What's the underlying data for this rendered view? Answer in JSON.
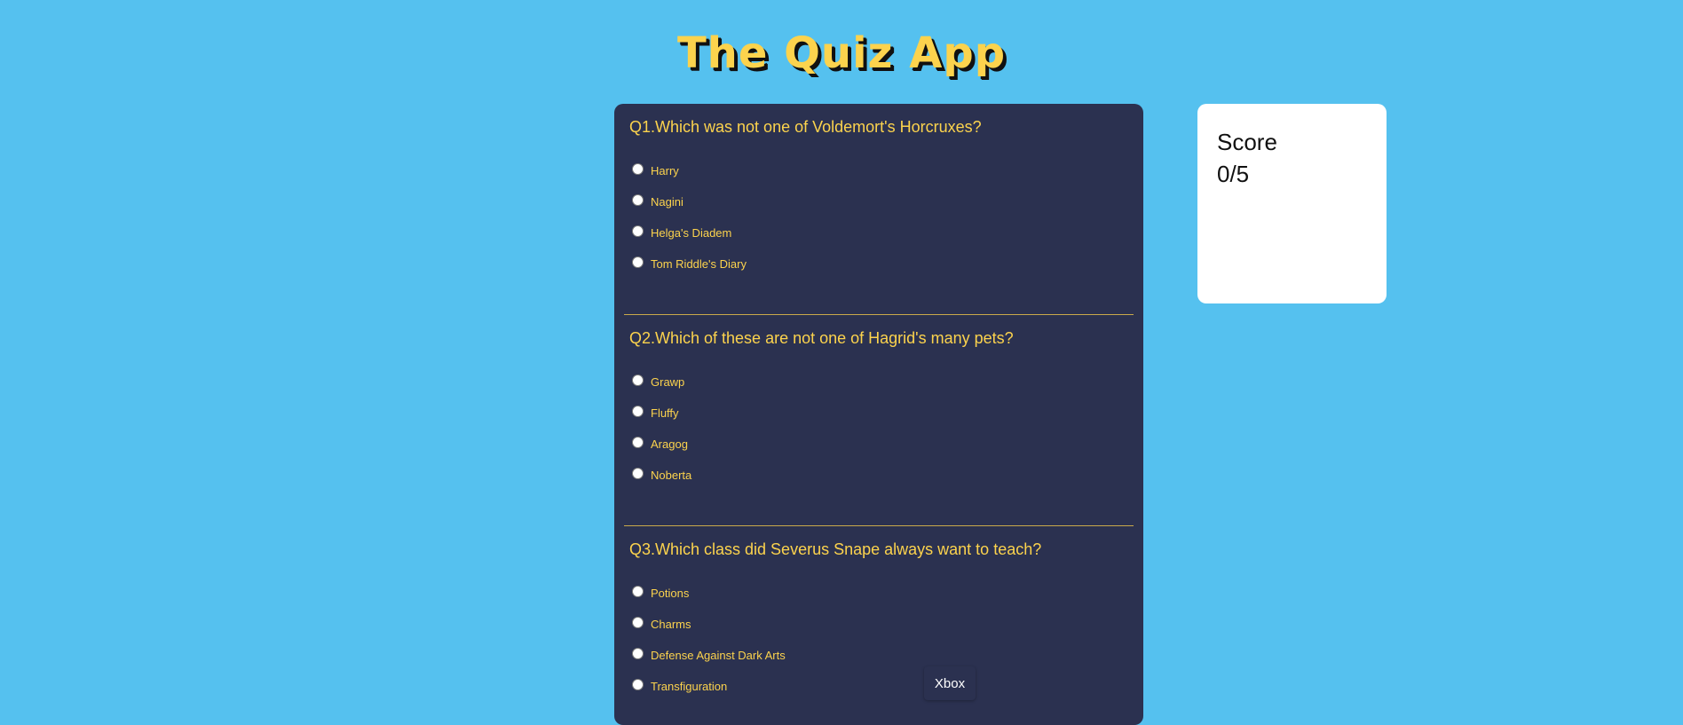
{
  "app": {
    "title": "The Quiz App"
  },
  "questions": [
    {
      "text": "Q1.Which was not one of Voldemort's Horcruxes?",
      "options": [
        "Harry",
        "Nagini",
        "Helga's Diadem",
        "Tom Riddle's Diary"
      ]
    },
    {
      "text": "Q2.Which of these are not one of Hagrid's many pets?",
      "options": [
        "Grawp",
        "Fluffy",
        "Aragog",
        "Noberta"
      ]
    },
    {
      "text": "Q3.Which class did Severus Snape always want to teach?",
      "options": [
        "Potions",
        "Charms",
        "Defense Against Dark Arts",
        "Transfiguration"
      ]
    }
  ],
  "score": {
    "label": "Score",
    "value": "0/5"
  },
  "tooltip": {
    "text": "Xbox"
  },
  "colors": {
    "background": "#55c1ef",
    "panel": "#2b3150",
    "accent": "#fcd34d",
    "card": "#ffffff"
  }
}
